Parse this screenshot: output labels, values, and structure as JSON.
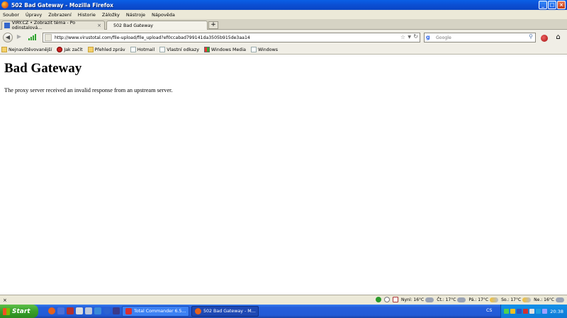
{
  "window": {
    "title": "502 Bad Gateway - Mozilla Firefox",
    "controls": {
      "minimize": "_",
      "maximize": "□",
      "close": "×"
    }
  },
  "menu": [
    "Soubor",
    "Úpravy",
    "Zobrazení",
    "Historie",
    "Záložky",
    "Nástroje",
    "Nápověda"
  ],
  "tabs": [
    {
      "label": "VIRY.CZ • Zobrazit téma - Po odinstalová...",
      "active": false
    },
    {
      "label": "502 Bad Gateway",
      "active": true
    }
  ],
  "new_tab_label": "+",
  "nav": {
    "back": "◀",
    "forward": "▶",
    "url": "http://www.virustotal.com/file-upload/file_upload?ef0ccabad799141da3505b915de3aa14",
    "star": "☆",
    "dropdown": "▼",
    "reload": "↻",
    "search_engine": "g",
    "search_placeholder": "Google",
    "search_icon": "⚲",
    "home": "⌂"
  },
  "bookmarks": [
    {
      "label": "Nejnavštěvovanější",
      "icon": "folder"
    },
    {
      "label": "Jak začít",
      "icon": "ladybug"
    },
    {
      "label": "Přehled zpráv",
      "icon": "folder"
    },
    {
      "label": "Hotmail",
      "icon": "page"
    },
    {
      "label": "Vlastní odkazy",
      "icon": "page"
    },
    {
      "label": "Windows Media",
      "icon": "win"
    },
    {
      "label": "Windows",
      "icon": "page"
    }
  ],
  "content": {
    "heading": "Bad Gateway",
    "message": "The proxy server received an invalid response from an upstream server."
  },
  "statusbar": {
    "close": "×",
    "weather": [
      {
        "label": "Nyní: 16°C",
        "icon": "cloud"
      },
      {
        "label": "Čt.: 17°C",
        "icon": "cloud"
      },
      {
        "label": "Pá.: 17°C",
        "icon": "sun-cloud"
      },
      {
        "label": "So.: 17°C",
        "icon": "sun-cloud"
      },
      {
        "label": "Ne.: 16°C",
        "icon": "cloud"
      }
    ]
  },
  "taskbar": {
    "start": "Start",
    "tasks": [
      {
        "label": "Total Commander 6.5...",
        "active": false
      },
      {
        "label": "502 Bad Gateway - M...",
        "active": true
      }
    ],
    "language": "CS",
    "clock": "20:38"
  },
  "colors": {
    "titlebar": "#0b4fd3",
    "taskbar": "#245edb",
    "start": "#38a02a"
  }
}
